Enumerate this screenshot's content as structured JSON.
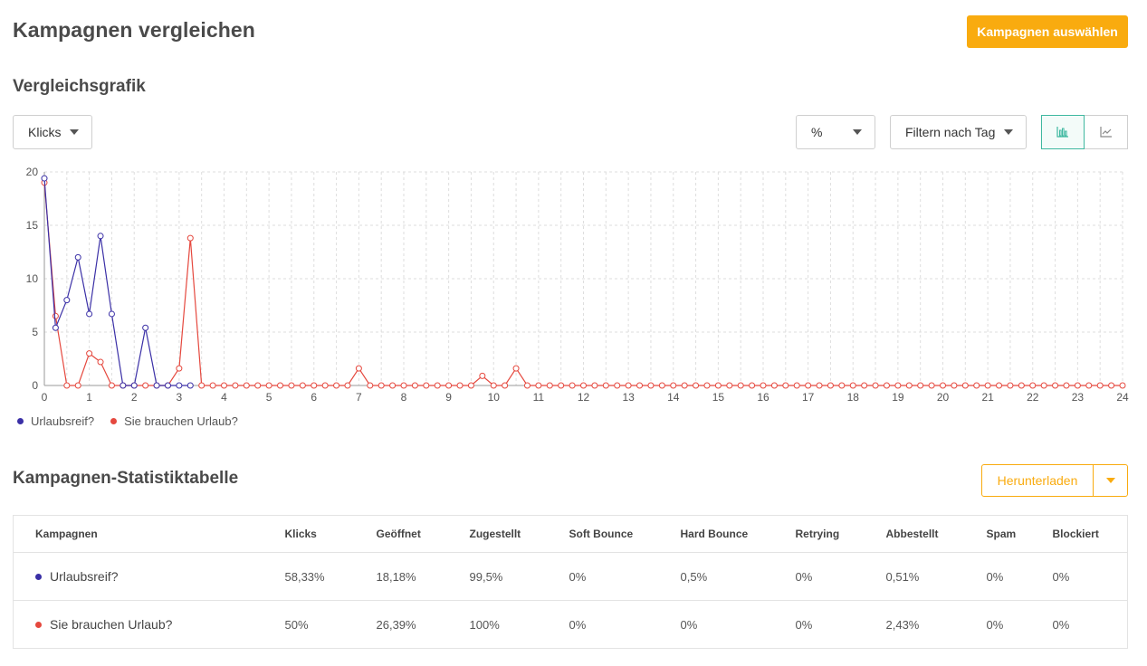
{
  "header": {
    "title": "Kampagnen vergleichen",
    "select_campaigns_label": "Kampagnen auswählen"
  },
  "chart_section": {
    "title": "Vergleichsgrafik",
    "metric_dropdown": "Klicks",
    "unit_dropdown": "%",
    "filter_dropdown": "Filtern nach Tag",
    "view_toggle": {
      "active": "bar-chart-icon"
    }
  },
  "chart_data": {
    "type": "line",
    "xlabel": "",
    "ylabel": "",
    "xlim": [
      0,
      24
    ],
    "ylim": [
      0,
      20
    ],
    "x_ticks": [
      "0",
      "1",
      "2",
      "3",
      "4",
      "5",
      "6",
      "7",
      "8",
      "9",
      "10",
      "11",
      "12",
      "13",
      "14",
      "15",
      "16",
      "17",
      "18",
      "19",
      "20",
      "21",
      "22",
      "23",
      "24"
    ],
    "y_ticks": [
      "0",
      "5",
      "10",
      "15",
      "20"
    ],
    "grid": true,
    "legend_position": "bottom-left",
    "series": [
      {
        "name": "Urlaubsreif?",
        "color": "#3a2fa6",
        "points": [
          [
            0,
            19.4
          ],
          [
            0.25,
            5.4
          ],
          [
            0.5,
            8.0
          ],
          [
            0.75,
            12.0
          ],
          [
            1.0,
            6.7
          ],
          [
            1.25,
            14.0
          ],
          [
            1.5,
            6.7
          ],
          [
            1.75,
            0
          ],
          [
            2.0,
            0
          ],
          [
            2.25,
            5.4
          ],
          [
            2.5,
            0
          ],
          [
            2.75,
            0
          ],
          [
            3.0,
            0
          ],
          [
            3.25,
            0
          ]
        ]
      },
      {
        "name": "Sie brauchen Urlaub?",
        "color": "#e5483e",
        "values_every_quarter_hour": [
          19.0,
          6.5,
          0,
          0,
          3.0,
          2.2,
          0,
          0,
          0,
          0,
          0,
          0,
          1.6,
          13.8,
          0,
          0,
          0,
          0,
          0,
          0,
          0,
          0,
          0,
          0,
          0,
          0,
          0,
          0,
          1.6,
          0,
          0,
          0,
          0,
          0,
          0,
          0,
          0,
          0,
          0,
          0.9,
          0,
          0,
          1.6,
          0,
          0,
          0,
          0,
          0,
          0,
          0,
          0,
          0,
          0,
          0,
          0,
          0,
          0,
          0,
          0,
          0,
          0,
          0,
          0,
          0,
          0,
          0,
          0,
          0,
          0,
          0,
          0,
          0,
          0,
          0,
          0,
          0,
          0,
          0,
          0,
          0,
          0,
          0,
          0,
          0,
          0,
          0,
          0,
          0,
          0,
          0,
          0,
          0,
          0,
          0,
          0,
          0,
          0
        ]
      }
    ]
  },
  "legend": [
    {
      "name": "Urlaubsreif?",
      "color": "#3a2fa6"
    },
    {
      "name": "Sie brauchen Urlaub?",
      "color": "#e5483e"
    }
  ],
  "table_section": {
    "title": "Kampagnen-Statistiktabelle",
    "download_label": "Herunterladen",
    "columns": [
      "Kampagnen",
      "Klicks",
      "Geöffnet",
      "Zugestellt",
      "Soft Bounce",
      "Hard Bounce",
      "Retrying",
      "Abbestellt",
      "Spam",
      "Blockiert"
    ],
    "rows": [
      {
        "name": "Urlaubsreif?",
        "color": "#3a2fa6",
        "cells": [
          "58,33%",
          "18,18%",
          "99,5%",
          "0%",
          "0,5%",
          "0%",
          "0,51%",
          "0%",
          "0%"
        ]
      },
      {
        "name": "Sie brauchen Urlaub?",
        "color": "#e5483e",
        "cells": [
          "50%",
          "26,39%",
          "100%",
          "0%",
          "0%",
          "0%",
          "2,43%",
          "0%",
          "0%"
        ]
      }
    ]
  }
}
